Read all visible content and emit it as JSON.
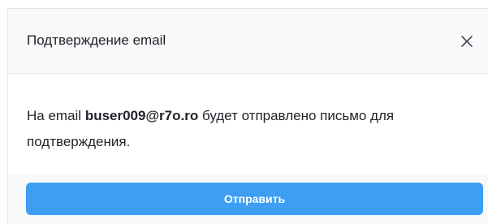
{
  "dialog": {
    "title": "Подтверждение email",
    "close_icon": "close-icon",
    "message": {
      "prefix": "На email ",
      "email": "buser009@r7o.ro",
      "suffix": " будет отправлено письмо для подтверждения."
    },
    "send_label": "Отправить"
  },
  "colors": {
    "accent": "#3d9ef2",
    "header_bg": "#f8f9fa",
    "text": "#1f2328"
  }
}
